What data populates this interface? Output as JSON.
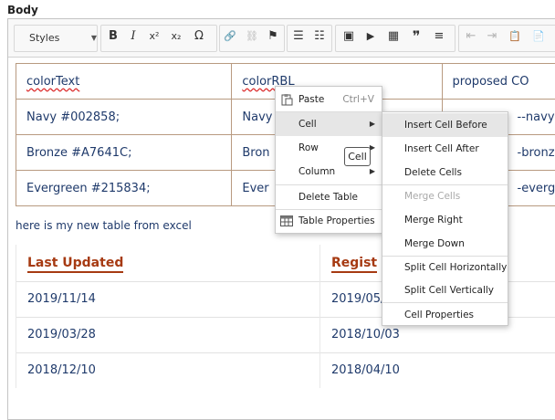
{
  "field": {
    "label": "Body"
  },
  "toolbar": {
    "styles_label": "Styles",
    "buttons": [
      {
        "icon": "bold-icon",
        "glyph": "B"
      },
      {
        "icon": "italic-icon",
        "glyph": "I"
      },
      {
        "icon": "superscript-icon",
        "glyph": "x²"
      },
      {
        "icon": "subscript-icon",
        "glyph": "x₂"
      },
      {
        "icon": "special-char-icon",
        "glyph": "Ω"
      },
      {
        "icon": "link-icon",
        "glyph": "🔗"
      },
      {
        "icon": "unlink-icon",
        "glyph": "⛓"
      },
      {
        "icon": "anchor-flag-icon",
        "glyph": "⚑"
      },
      {
        "icon": "bulleted-list-icon",
        "glyph": "☰"
      },
      {
        "icon": "numbered-list-icon",
        "glyph": "☷"
      },
      {
        "icon": "image-icon",
        "glyph": "▣"
      },
      {
        "icon": "media-icon",
        "glyph": "▶"
      },
      {
        "icon": "table-icon",
        "glyph": "▦"
      },
      {
        "icon": "blockquote-icon",
        "glyph": "❞"
      },
      {
        "icon": "horizontal-rule-icon",
        "glyph": "≡"
      },
      {
        "icon": "outdent-icon",
        "glyph": "⇤"
      },
      {
        "icon": "indent-icon",
        "glyph": "⇥"
      },
      {
        "icon": "paste-text-icon",
        "glyph": "📋"
      },
      {
        "icon": "paste-word-icon",
        "glyph": "📄"
      }
    ]
  },
  "color_table": {
    "rows": [
      [
        "colorText",
        "colorRBL",
        "proposed CO"
      ],
      [
        "Navy #002858;",
        "Navy",
        "--navy: #"
      ],
      [
        "Bronze #A7641C;",
        "Bron",
        "-bronze"
      ],
      [
        "Evergreen #215834;",
        "Ever",
        "-evergr"
      ]
    ]
  },
  "excel_note": "here is my new table from excel",
  "date_table": {
    "headers": [
      "Last Updated",
      "Regist"
    ],
    "rows": [
      [
        "2019/11/14",
        "2019/05/"
      ],
      [
        "2019/03/28",
        "2018/10/03"
      ],
      [
        "2018/12/10",
        "2018/04/10"
      ]
    ]
  },
  "context_menu": {
    "paste_label": "Paste",
    "paste_shortcut": "Ctrl+V",
    "cell_label": "Cell",
    "row_label": "Row",
    "column_label": "Column",
    "delete_table_label": "Delete Table",
    "table_properties_label": "Table Properties"
  },
  "tooltip": {
    "text": "Cell"
  },
  "cell_submenu": {
    "insert_before": "Insert Cell Before",
    "insert_after": "Insert Cell After",
    "delete_cells": "Delete Cells",
    "merge_cells": "Merge Cells",
    "merge_right": "Merge Right",
    "merge_down": "Merge Down",
    "split_horizontal": "Split Cell Horizontally",
    "split_vertical": "Split Cell Vertically",
    "cell_properties": "Cell Properties"
  }
}
